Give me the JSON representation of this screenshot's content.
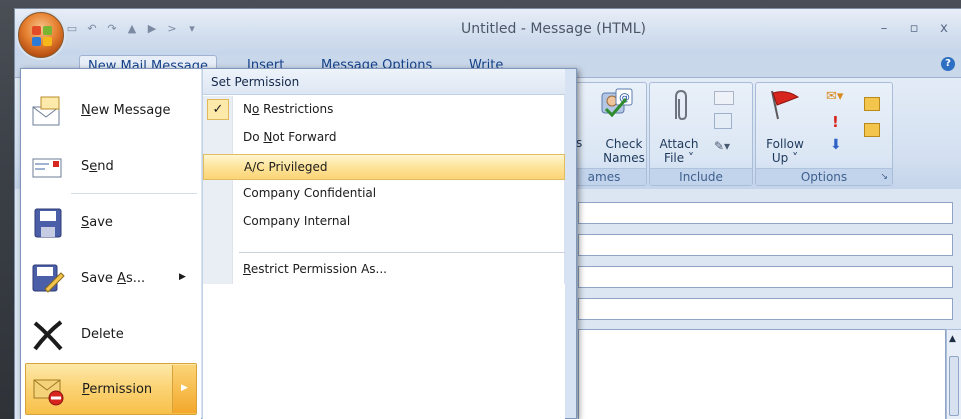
{
  "window": {
    "title": "Untitled - Message (HTML)",
    "minimize_label": "–",
    "restore_label": "▫",
    "close_label": "x"
  },
  "tabs": [
    {
      "label": "New Mail Message",
      "active": true
    },
    {
      "label": "Insert"
    },
    {
      "label": "Message Options"
    },
    {
      "label": "Write"
    }
  ],
  "ribbon": {
    "check_names": {
      "line1": "Check",
      "line2": "Names"
    },
    "names_group_fragment": "ames",
    "attach_file": {
      "line1": "Attach",
      "line2": "File ˅"
    },
    "include_group": "Include",
    "follow_up": {
      "line1": "Follow",
      "line2": "Up ˅"
    },
    "options_group": "Options",
    "left_fragment": "s"
  },
  "office_menu": {
    "items": [
      {
        "label_prefix": "",
        "accel": "N",
        "label_rest": "ew Message",
        "icon": "new-message-icon"
      },
      {
        "label_prefix": "S",
        "accel": "e",
        "label_rest": "nd",
        "icon": "send-icon"
      },
      {
        "label_prefix": "",
        "accel": "S",
        "label_rest": "ave",
        "icon": "save-icon"
      },
      {
        "label_prefix": "Save ",
        "accel": "A",
        "label_rest": "s...",
        "icon": "save-as-icon",
        "submenu": true
      },
      {
        "label_prefix": "",
        "accel": "D",
        "label_rest": "elete",
        "icon": "delete-icon",
        "plain": "Delete"
      },
      {
        "label_prefix": "",
        "accel": "P",
        "label_rest": "ermission",
        "icon": "permission-icon",
        "submenu": true,
        "active": true
      }
    ]
  },
  "permission_submenu": {
    "header": "Set Permission",
    "items": [
      {
        "label_prefix": "N",
        "accel": "o",
        "label_rest": " Restrictions",
        "checked": true
      },
      {
        "label_prefix": "Do ",
        "accel": "N",
        "label_rest": "ot Forward"
      },
      {
        "label": "A/C Privileged",
        "highlighted": true
      },
      {
        "label": "Company Confidential"
      },
      {
        "label": "Company Internal"
      },
      {
        "label_prefix": "",
        "accel": "R",
        "label_rest": "estrict Permission As..."
      }
    ],
    "check_mark": "✓"
  },
  "colors": {
    "accent_text": "#15428b",
    "highlight": "#fbd477",
    "menu_border": "#7f97bd"
  }
}
